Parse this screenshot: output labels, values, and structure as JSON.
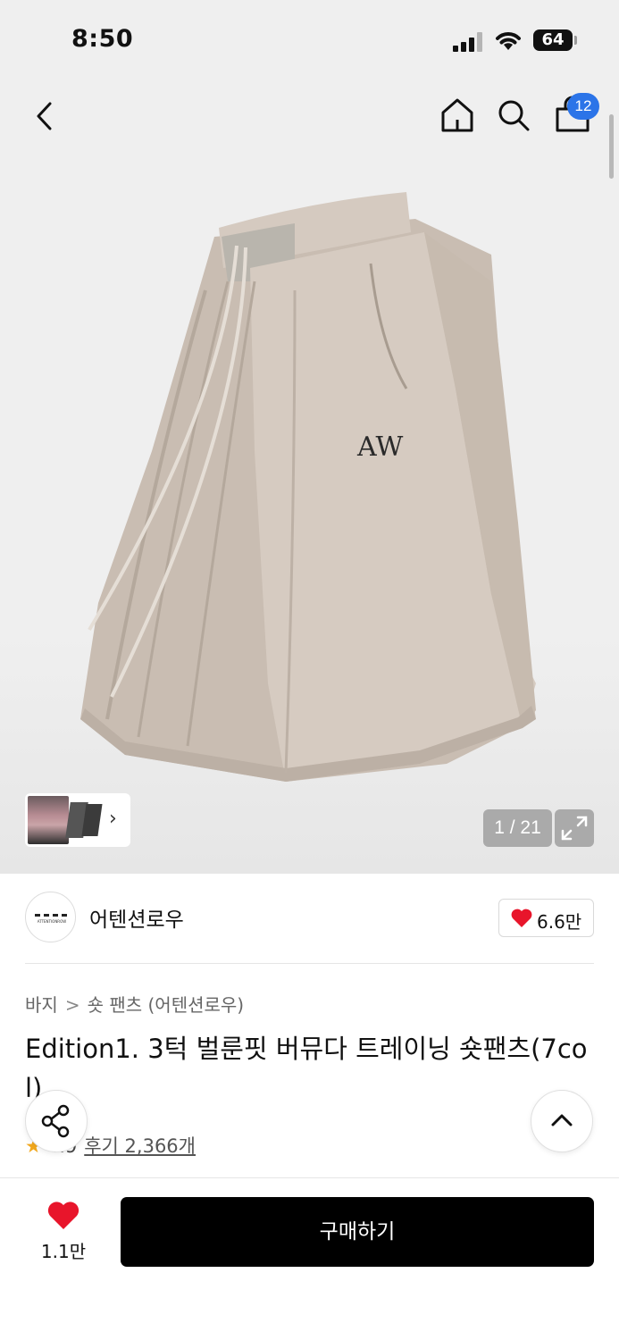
{
  "status_bar": {
    "time": "8:50",
    "battery": "64"
  },
  "header": {
    "icons": [
      "back-icon",
      "home-icon",
      "search-icon",
      "shopping-bag-icon"
    ],
    "cart_badge": "12"
  },
  "gallery": {
    "counter": "1 / 21",
    "thumbnail_chevron": "›"
  },
  "brand": {
    "name": "어텐션로우",
    "logo_text": "ATTENTIONROW",
    "like_count": "6.6만"
  },
  "breadcrumb": {
    "category": "바지",
    "separator": ">",
    "subcategory": "숏 팬츠 (어텐션로우)"
  },
  "product": {
    "title": "Edition1. 3턱 벌룬핏 버뮤다 트레이닝 숏팬츠(7col)",
    "rating": "4.9",
    "reviews": "후기 2,366개"
  },
  "bottom_bar": {
    "wish_count": "1.1만",
    "buy_label": "구매하기"
  },
  "colors": {
    "accent_blue": "#2b74e8",
    "heart_red": "#e8152b",
    "star": "#f2a81d",
    "buy_button": "#000000"
  }
}
